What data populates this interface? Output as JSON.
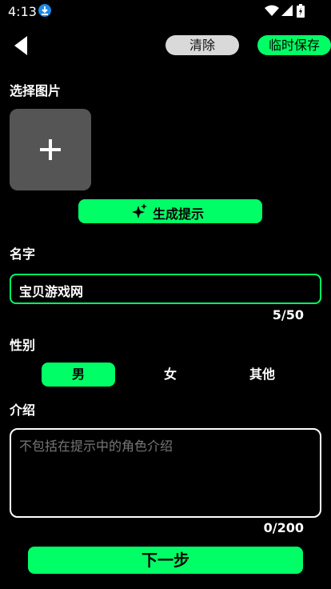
{
  "status_bar": {
    "time": "4:13"
  },
  "header": {
    "clear_label": "清除",
    "save_label": "临时保存"
  },
  "image_section": {
    "label": "选择图片",
    "generate_button_label": "生成提示"
  },
  "name_section": {
    "label": "名字",
    "value": "宝贝游戏网",
    "counter": "5/50"
  },
  "gender_section": {
    "label": "性别",
    "options": [
      "男",
      "女",
      "其他"
    ],
    "selected": "男"
  },
  "intro_section": {
    "label": "介绍",
    "placeholder": "不包括在提示中的角色介绍",
    "counter": "0/200"
  },
  "footer": {
    "next_label": "下一步"
  },
  "colors": {
    "accent": "#00ff66",
    "background": "#000000",
    "clear_button": "#d9d9d9",
    "upload_box": "#555555",
    "download_badge": "#1e88e5"
  },
  "icons": [
    "download-icon",
    "wifi-icon",
    "signal-icon",
    "battery-icon",
    "back-arrow-icon",
    "plus-icon",
    "sparkle-icon"
  ]
}
